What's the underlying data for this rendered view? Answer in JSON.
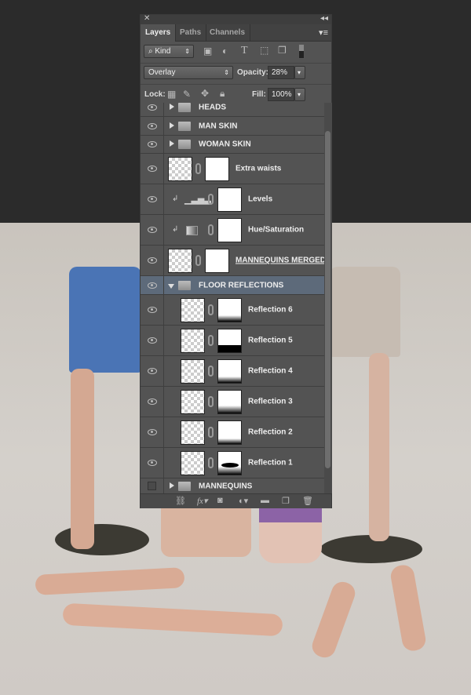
{
  "panel": {
    "tabs": [
      "Layers",
      "Paths",
      "Channels"
    ],
    "filter": {
      "kind_label": "Kind"
    },
    "blend_mode": "Overlay",
    "opacity_label": "Opacity:",
    "opacity_value": "28%",
    "lock_label": "Lock:",
    "fill_label": "Fill:",
    "fill_value": "100%",
    "layers": [
      {
        "name": "HEADS",
        "type": "group",
        "visible": true
      },
      {
        "name": "MAN SKIN",
        "type": "group",
        "visible": true
      },
      {
        "name": "WOMAN SKIN",
        "type": "group",
        "visible": true
      },
      {
        "name": "Extra waists",
        "type": "layer",
        "visible": true
      },
      {
        "name": "Levels",
        "type": "adjustment",
        "visible": true
      },
      {
        "name": "Hue/Saturation",
        "type": "adjustment",
        "visible": true
      },
      {
        "name": "MANNEQUINS MERGED",
        "type": "smart",
        "visible": true
      },
      {
        "name": "FLOOR REFLECTIONS",
        "type": "group",
        "visible": true,
        "selected": true,
        "expanded": true
      },
      {
        "name": "Reflection 6",
        "type": "layer",
        "visible": true
      },
      {
        "name": "Reflection 5",
        "type": "layer",
        "visible": true
      },
      {
        "name": "Reflection 4",
        "type": "layer",
        "visible": true
      },
      {
        "name": "Reflection 3",
        "type": "layer",
        "visible": true
      },
      {
        "name": "Reflection 2",
        "type": "layer",
        "visible": true
      },
      {
        "name": "Reflection 1",
        "type": "layer",
        "visible": true
      },
      {
        "name": "MANNEQUINS",
        "type": "group",
        "visible": false
      }
    ]
  }
}
